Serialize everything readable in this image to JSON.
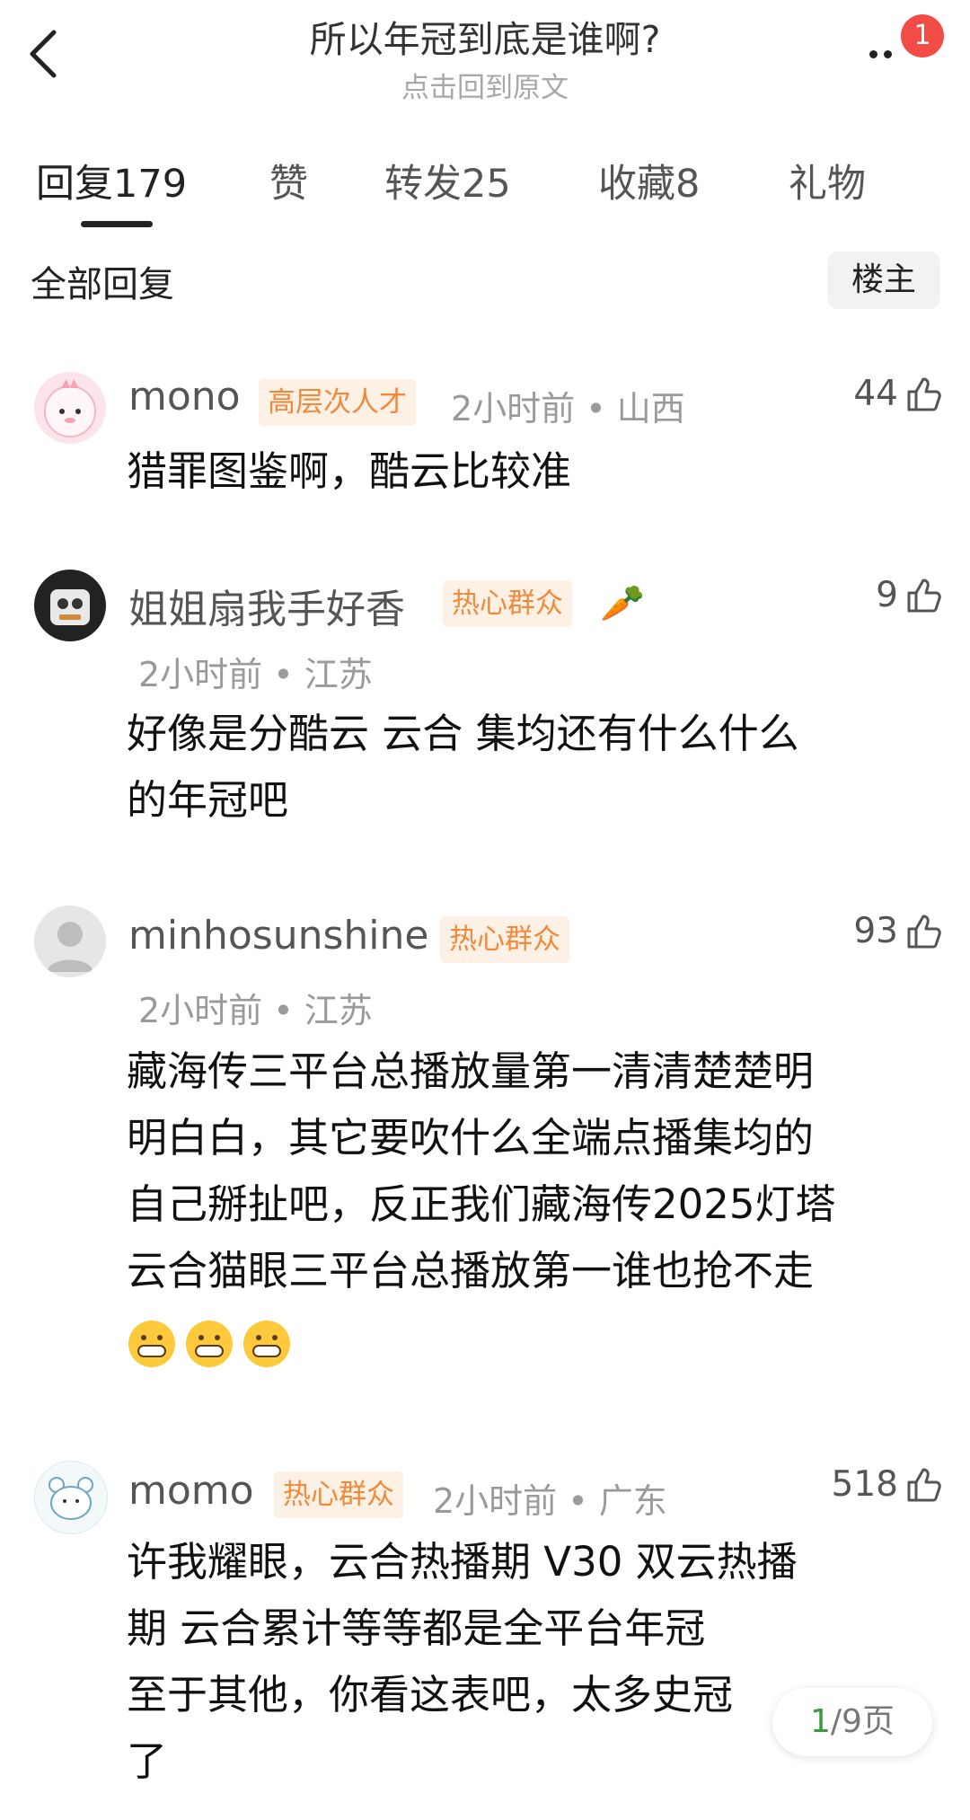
{
  "header": {
    "title": "所以年冠到底是谁啊?",
    "subtitle": "点击回到原文",
    "notification_count": "1"
  },
  "tabs": [
    {
      "label": "回复",
      "count": "179"
    },
    {
      "label": "赞",
      "count": ""
    },
    {
      "label": "转发",
      "count": "25"
    },
    {
      "label": "收藏",
      "count": "8"
    },
    {
      "label": "礼物",
      "count": ""
    }
  ],
  "section": {
    "title": "全部回复",
    "filter_button": "楼主"
  },
  "comments": [
    {
      "username": "mono",
      "tag": "高层次人才",
      "time": "2小时前",
      "location": "山西",
      "likes": "44",
      "lines": [
        "猎罪图鉴啊，酷云比较准"
      ]
    },
    {
      "username": "姐姐扇我手好香",
      "tag": "热心群众",
      "time": "2小时前",
      "location": "江苏",
      "likes": "9",
      "lines": [
        "好像是分酷云  云合  集均还有什么什么",
        "的年冠吧"
      ]
    },
    {
      "username": "minhosunshine",
      "tag": "热心群众",
      "time": "2小时前",
      "location": "江苏",
      "likes": "93",
      "lines": [
        "藏海传三平台总播放量第一清清楚楚明",
        "明白白，其它要吹什么全端点播集均的",
        "自己掰扯吧，反正我们藏海传2025灯塔",
        "云合猫眼三平台总播放第一谁也抢不走"
      ]
    },
    {
      "username": "momo",
      "tag": "热心群众",
      "time": "2小时前",
      "location": "广东",
      "likes": "518",
      "lines": [
        "许我耀眼，云合热播期 V30 双云热播",
        "期 云合累计等等都是全平台年冠",
        "至于其他，你看这表吧，太多史冠",
        "了"
      ]
    }
  ],
  "pager": {
    "current": "1",
    "total": "/9页"
  },
  "colors": {
    "tag_bg": "#fdf1e6",
    "tag_text": "#f08a3a",
    "badge": "#f24c47",
    "pager_current": "#3c9a3c"
  }
}
